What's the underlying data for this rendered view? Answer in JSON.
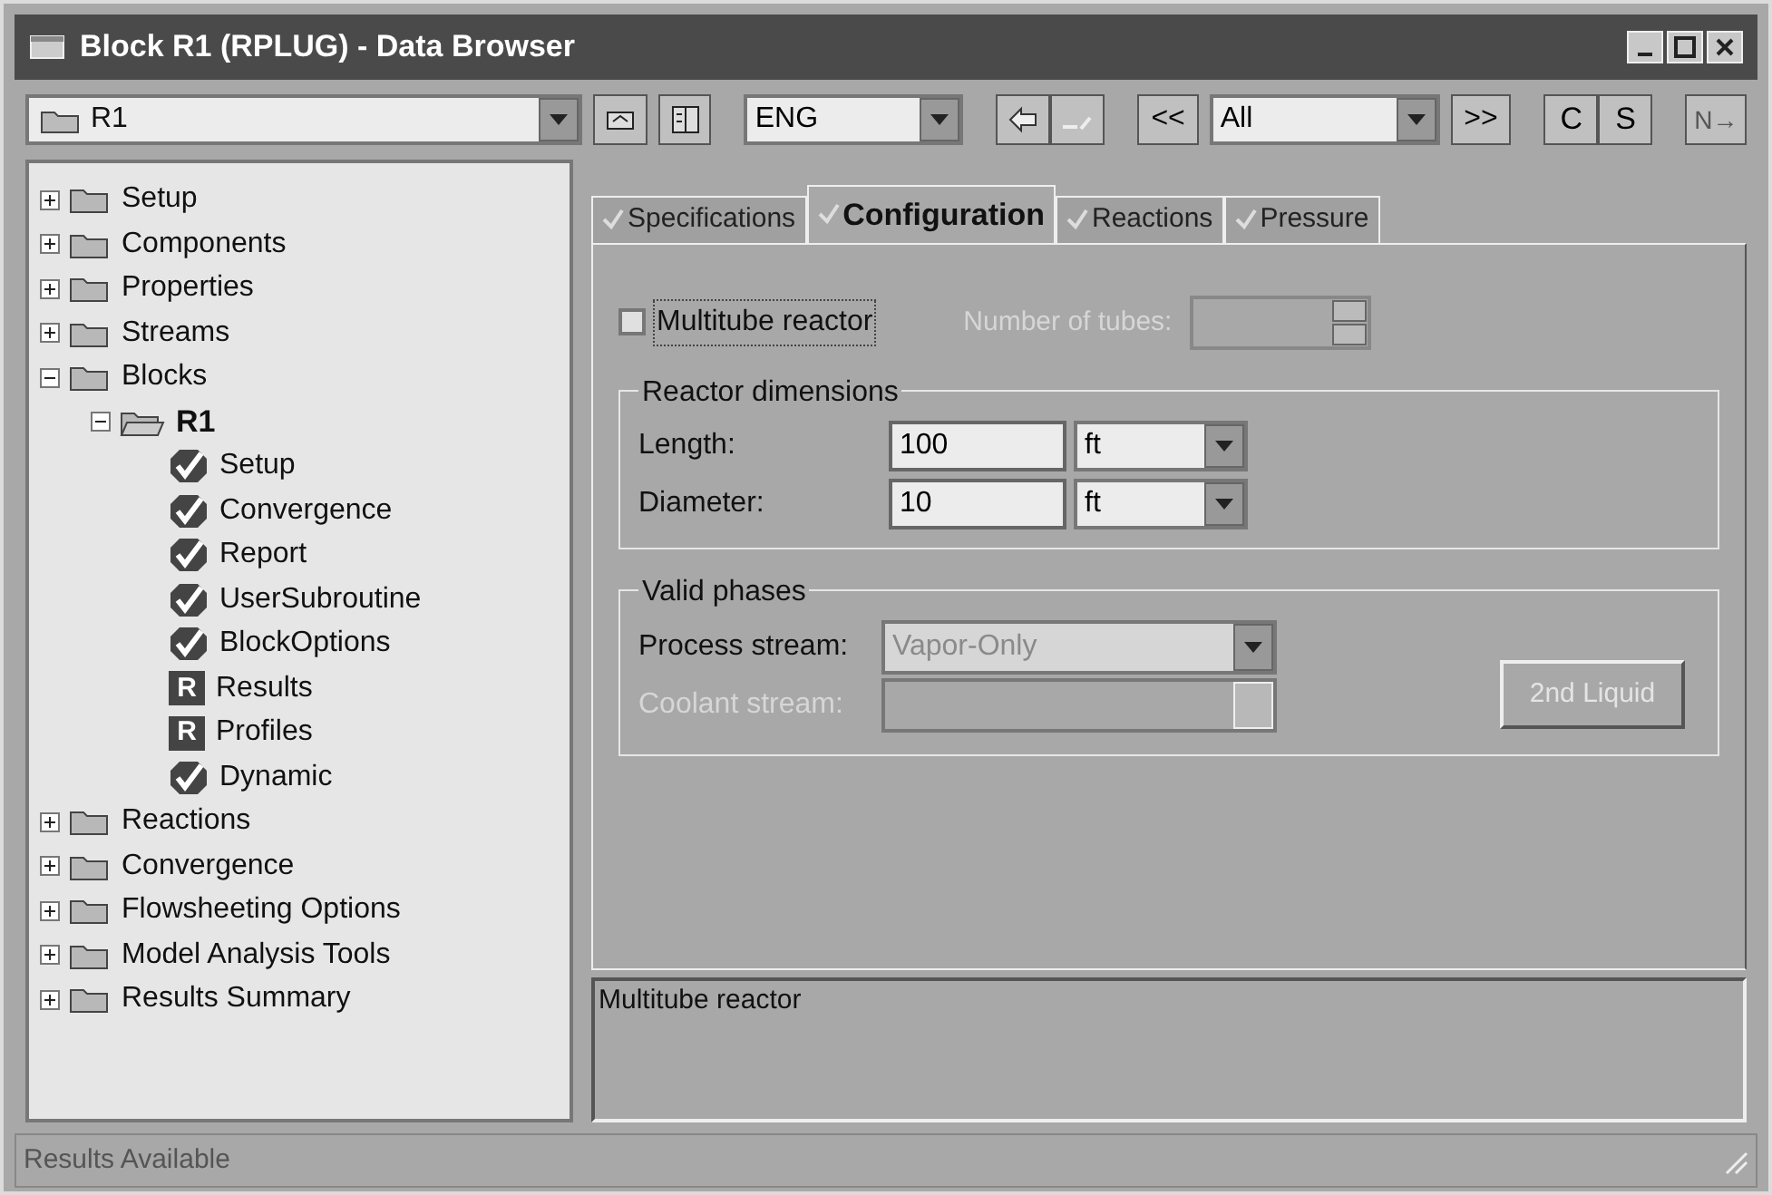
{
  "window": {
    "title": "Block R1 (RPLUG) - Data Browser"
  },
  "toolbar": {
    "block_select": "R1",
    "units": "ENG",
    "filter": "All",
    "nav_buttons": [
      "<<",
      ">>"
    ],
    "letter_buttons": [
      "C",
      "S"
    ],
    "next_button": "N→"
  },
  "tree": [
    {
      "label": "Setup",
      "kind": "folder",
      "expanded": false
    },
    {
      "label": "Components",
      "kind": "folder",
      "expanded": false
    },
    {
      "label": "Properties",
      "kind": "folder",
      "expanded": false
    },
    {
      "label": "Streams",
      "kind": "folder",
      "expanded": false
    },
    {
      "label": "Blocks",
      "kind": "folder",
      "expanded": true,
      "children": [
        {
          "label": "R1",
          "kind": "block",
          "expanded": true,
          "children": [
            {
              "label": "Setup",
              "kind": "complete"
            },
            {
              "label": "Convergence",
              "kind": "complete"
            },
            {
              "label": "Report",
              "kind": "complete"
            },
            {
              "label": "UserSubroutine",
              "kind": "complete"
            },
            {
              "label": "BlockOptions",
              "kind": "complete"
            },
            {
              "label": "Results",
              "kind": "results",
              "badge": "R"
            },
            {
              "label": "Profiles",
              "kind": "results",
              "badge": "R"
            },
            {
              "label": "Dynamic",
              "kind": "complete"
            }
          ]
        }
      ]
    },
    {
      "label": "Reactions",
      "kind": "folder",
      "expanded": false
    },
    {
      "label": "Convergence",
      "kind": "folder",
      "expanded": false
    },
    {
      "label": "Flowsheeting Options",
      "kind": "folder",
      "expanded": false
    },
    {
      "label": "Model Analysis Tools",
      "kind": "folder",
      "expanded": false
    },
    {
      "label": "Results Summary",
      "kind": "folder",
      "expanded": false
    }
  ],
  "tabs": [
    {
      "label": "Specifications",
      "selected": false
    },
    {
      "label": "Configuration",
      "selected": true
    },
    {
      "label": "Reactions",
      "selected": false
    },
    {
      "label": "Pressure",
      "selected": false
    }
  ],
  "multitube": {
    "label": "Multitube reactor",
    "checked": false,
    "tubes_label": "Number of tubes:"
  },
  "reactor_dimensions": {
    "title": "Reactor dimensions",
    "rows": [
      {
        "label": "Length:",
        "value": "100",
        "unit": "ft"
      },
      {
        "label": "Diameter:",
        "value": "10",
        "unit": "ft"
      }
    ]
  },
  "valid_phases": {
    "title": "Valid phases",
    "rows": [
      {
        "label": "Process stream:",
        "value": "Vapor-Only",
        "disabled": false
      },
      {
        "label": "Coolant stream:",
        "disabled": true
      }
    ],
    "button": "2nd Liquid"
  },
  "description": "Multitube reactor",
  "status_bar": "Results Available"
}
